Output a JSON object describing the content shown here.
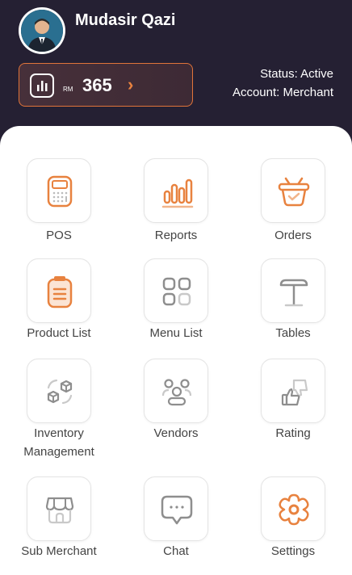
{
  "profile": {
    "name": "Mudasir Qazi"
  },
  "balance": {
    "currency": "RM",
    "value": "365"
  },
  "status": {
    "status_line": "Status: Active",
    "account_line": "Account: Merchant"
  },
  "menu": {
    "pos": "POS",
    "reports": "Reports",
    "orders": "Orders",
    "product_list": "Product List",
    "menu_list": "Menu List",
    "tables": "Tables",
    "inventory_line1": "Inventory",
    "inventory_line2": "Management",
    "vendors": "Vendors",
    "rating": "Rating",
    "sub_merchant": "Sub Merchant",
    "chat": "Chat",
    "settings": "Settings"
  },
  "colors": {
    "header_bg": "#252033",
    "accent": "#e8823f",
    "icon_gray": "#9b9b9b"
  }
}
